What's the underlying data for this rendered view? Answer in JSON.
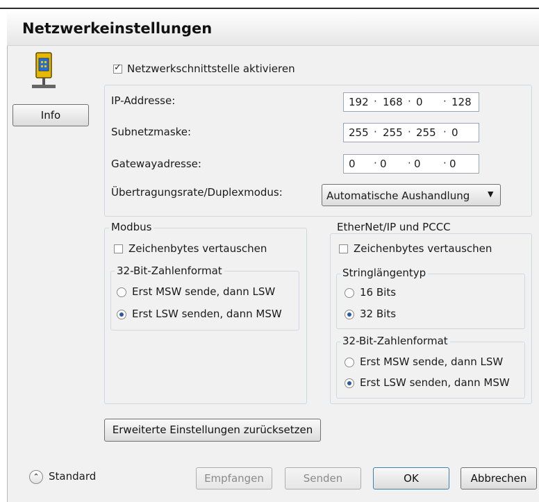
{
  "dialog": {
    "title": "Netzwerkeinstellungen"
  },
  "sidebar": {
    "info_button": "Info",
    "device_icon": "network-device-icon"
  },
  "enable": {
    "label": "Netzwerkschnittstelle aktivieren",
    "checked": true
  },
  "ip": {
    "ip_label": "IP-Addresse:",
    "ip_octets": [
      "192",
      "168",
      "0",
      "128"
    ],
    "subnet_label": "Subnetzmaske:",
    "subnet_octets": [
      "255",
      "255",
      "255",
      "0"
    ],
    "gateway_label": "Gatewayadresse:",
    "gateway_octets": [
      "0",
      "0",
      "0",
      "0"
    ],
    "rate_label": "Übertragungsrate/Duplexmodus:",
    "rate_value": "Automatische Aushandlung"
  },
  "modbus": {
    "title": "Modbus",
    "swap_label": "Zeichenbytes vertauschen",
    "swap_checked": false,
    "format_title": "32-Bit-Zahlenformat",
    "option_msw": "Erst MSW sende, dann LSW",
    "option_lsw": "Erst LSW senden, dann MSW",
    "selected": "lsw"
  },
  "ethernet": {
    "title": "EtherNet/IP und PCCC",
    "swap_label": "Zeichenbytes vertauschen",
    "swap_checked": false,
    "string_title": "Stringlängentyp",
    "option_16": "16 Bits",
    "option_32": "32 Bits",
    "string_selected": "32",
    "format_title": "32-Bit-Zahlenformat",
    "option_msw": "Erst MSW sende, dann LSW",
    "option_lsw": "Erst LSW senden, dann MSW",
    "selected": "lsw"
  },
  "reset_button": "Erweiterte Einstellungen zurücksetzen",
  "footer": {
    "standard_label": "Standard",
    "receive": "Empfangen",
    "send": "Senden",
    "ok": "OK",
    "cancel": "Abbrechen"
  },
  "colors": {
    "accent": "#2c5aa0",
    "icon_yellow": "#f5c400",
    "icon_blue": "#2a6fc9"
  }
}
